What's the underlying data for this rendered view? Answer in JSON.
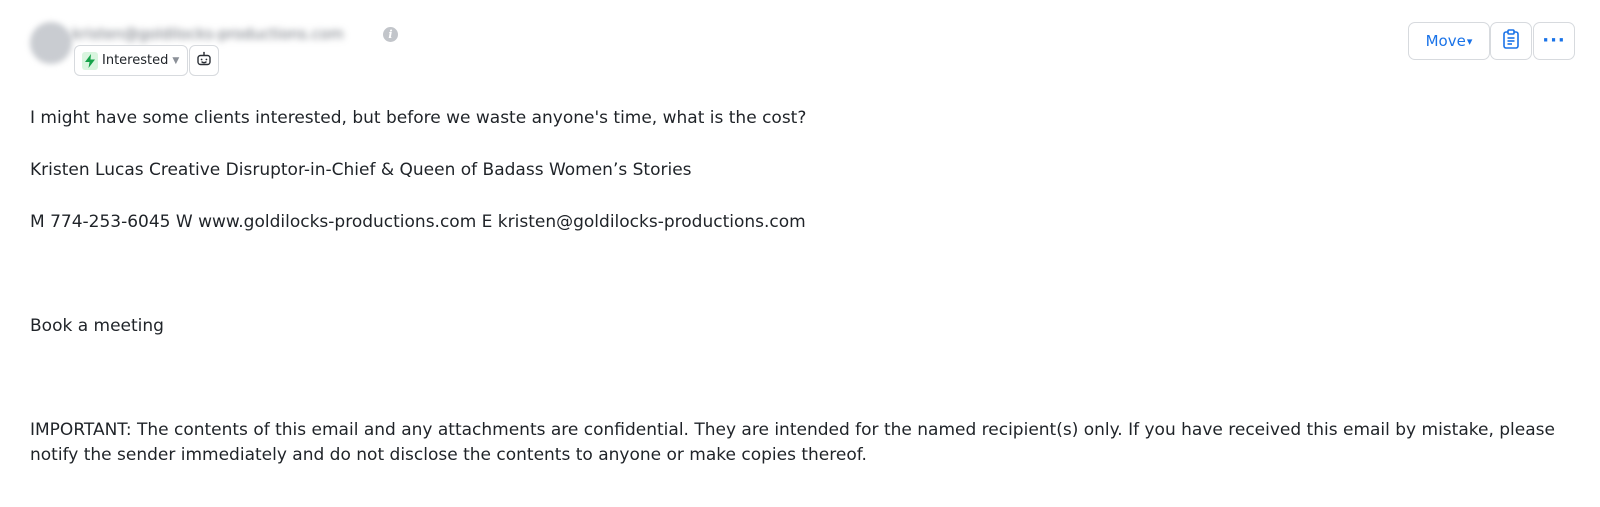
{
  "header": {
    "sender_email": "kristen@goldilocks-productions.com",
    "status": {
      "label": "Interested",
      "icon": "bolt-icon",
      "icon_color": "#16a34a",
      "icon_bg": "#d9f5df"
    },
    "bot_icon": "robot-icon",
    "info_icon": "info-icon"
  },
  "actions": {
    "move_label": "Move",
    "move_caret": "▾",
    "clipboard_icon": "clipboard-icon",
    "more_label": "···",
    "accent_color": "#1a73e8"
  },
  "email": {
    "question": "I might have some clients interested, but before we waste anyone's time, what is the cost?",
    "signature_name": "Kristen Lucas Creative Disruptor-in-Chief & Queen of Badass Women’s Stories",
    "contact": "M 774-253-6045 W www.goldilocks-productions.com E kristen@goldilocks-productions.com",
    "book_meeting": "Book a meeting",
    "disclaimer": "IMPORTANT: The contents of this email and any attachments are confidential. They are intended for the named recipient(s) only. If you have received this email by mistake, please notify the sender immediately and do not disclose the contents to anyone or make copies thereof."
  }
}
